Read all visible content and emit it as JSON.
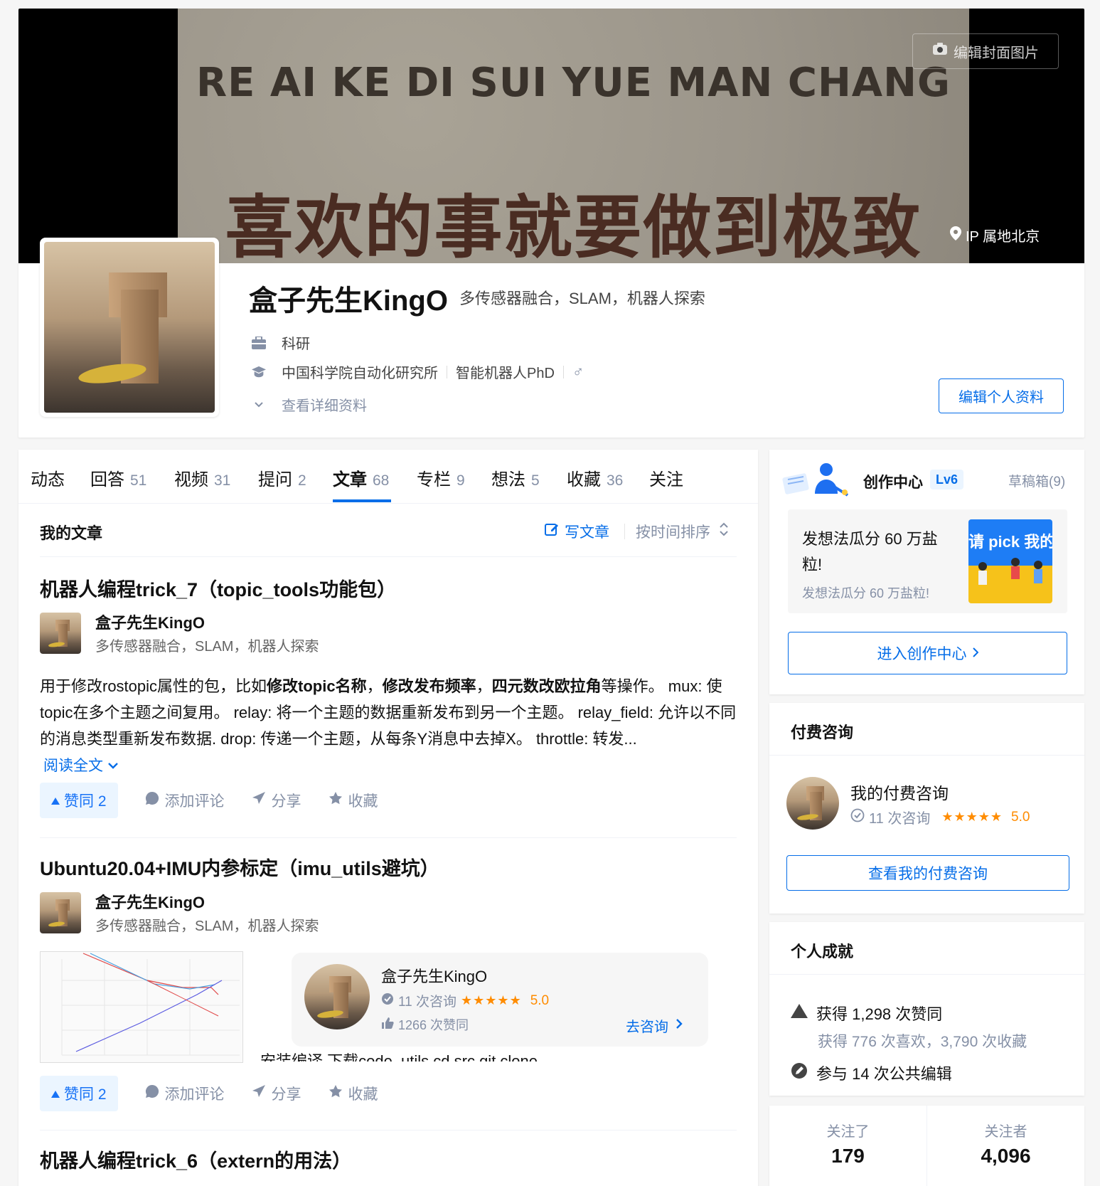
{
  "cover": {
    "line1": "RE AI KE DI SUI YUE MAN CHANG",
    "line2": "喜欢的事就要做到极致",
    "edit_button": "编辑封面图片",
    "ip_location": "IP 属地北京"
  },
  "profile": {
    "name": "盒子先生KingO",
    "headline": "多传感器融合，SLAM，机器人探索",
    "industry": "科研",
    "school": "中国科学院自动化研究所",
    "major": "智能机器人PhD",
    "gender_symbol": "♂",
    "view_details": "查看详细资料",
    "edit_button": "编辑个人资料"
  },
  "tabs": [
    {
      "label": "动态",
      "count": ""
    },
    {
      "label": "回答",
      "count": "51"
    },
    {
      "label": "视频",
      "count": "31"
    },
    {
      "label": "提问",
      "count": "2"
    },
    {
      "label": "文章",
      "count": "68"
    },
    {
      "label": "专栏",
      "count": "9"
    },
    {
      "label": "想法",
      "count": "5"
    },
    {
      "label": "收藏",
      "count": "36"
    },
    {
      "label": "关注",
      "count": ""
    }
  ],
  "section": {
    "title": "我的文章",
    "write_label": "写文章",
    "sort_label": "按时间排序"
  },
  "articles": [
    {
      "title": "机器人编程trick_7（topic_tools功能包）",
      "author": "盒子先生KingO",
      "author_headline": "多传感器融合，SLAM，机器人探索",
      "excerpt_parts": [
        "用于修改rostopic属性的包，比如",
        "修改topic名称",
        "，",
        "修改发布频率",
        "，",
        "四元数改欧拉角",
        "等操作。 mux: 使topic在多个主题之间复用。 relay: 将一个主题的数据重新发布到另一个主题。 relay_field: 允许以不同的消息类型重新发布数据. drop: 传递一个主题，从每条Y消息中去掉X。 throttle: 转发..."
      ],
      "read_full": "阅读全文",
      "vote": "赞同 2",
      "comment": "添加评论",
      "share": "分享",
      "favorite": "收藏"
    },
    {
      "title": "Ubuntu20.04+IMU内参标定（imu_utils避坑）",
      "author": "盒子先生KingO",
      "author_headline": "多传感器融合，SLAM，机器人探索",
      "excerpt_cut": "安装编译 下载code_utils cd src git clone",
      "vote": "赞同 2",
      "comment": "添加评论",
      "share": "分享",
      "favorite": "收藏"
    },
    {
      "title": "机器人编程trick_6（extern的用法）"
    }
  ],
  "consult_popup": {
    "name": "盒子先生KingO",
    "consult_count": "11 次咨询",
    "stars": "★★★★★",
    "rating": "5.0",
    "likes": "1266 次赞同",
    "go_label": "去咨询"
  },
  "creator": {
    "title": "创作中心",
    "level": "Lv6",
    "drafts": "草稿箱(9)",
    "promo_title": "发想法瓜分 60 万盐粒!",
    "promo_sub": "发想法瓜分 60 万盐粒!",
    "promo_image_text": "请 pick 我的母",
    "enter_button": "进入创作中心"
  },
  "paid": {
    "title": "付费咨询",
    "name": "我的付费咨询",
    "consult_count": "11 次咨询",
    "stars": "★★★★★",
    "rating": "5.0",
    "button": "查看我的付费咨询"
  },
  "achievements": {
    "title": "个人成就",
    "votes": "获得 1,298 次赞同",
    "likes_favs": "获得 776 次喜欢，3,790 次收藏",
    "edits": "参与 14 次公共编辑"
  },
  "follow": {
    "following_label": "关注了",
    "following_count": "179",
    "followers_label": "关注者",
    "followers_count": "4,096"
  },
  "colors": {
    "accent": "#056de8",
    "star": "#ff8c00",
    "muted": "#8590a6"
  }
}
